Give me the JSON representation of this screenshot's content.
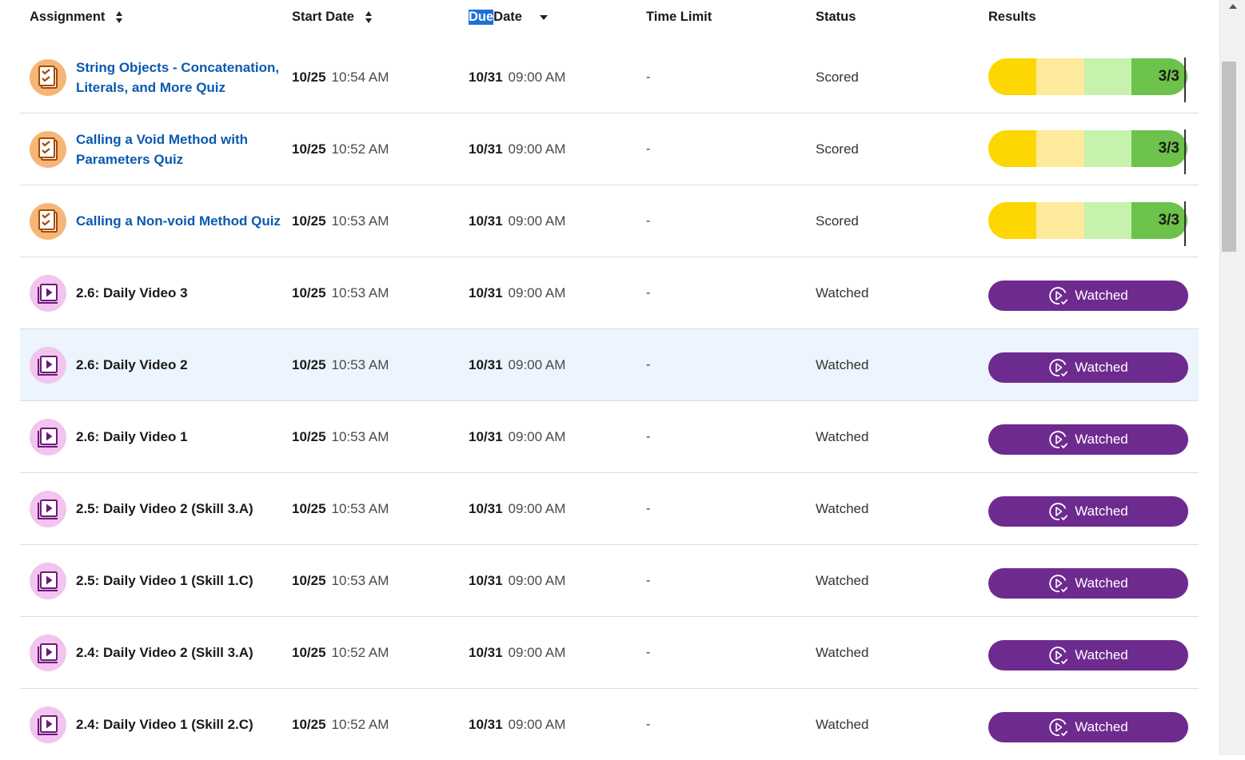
{
  "header": {
    "assignment": "Assignment",
    "start_date": "Start Date",
    "due_highlight": "Due",
    "due_rest": "Date",
    "time_limit": "Time Limit",
    "status": "Status",
    "results": "Results"
  },
  "colors": {
    "link": "#0a5ab0",
    "watched_button": "#6e2b8f",
    "score_segments": [
      "#fcd702",
      "#fdea9a",
      "#c6f2ad",
      "#6cc24a"
    ],
    "quiz_icon_bg": "#f5b677",
    "video_icon_bg": "#f2c4ee",
    "row_hover": "#ecf4fd"
  },
  "icons": {
    "quiz": "quiz-checklist-icon",
    "video": "video-play-icon",
    "watched": "play-check-icon"
  },
  "rows": [
    {
      "type": "quiz",
      "title": "String Objects - Concatenation, Literals, and More Quiz",
      "start_day": "10/25",
      "start_time": "10:54 AM",
      "due_day": "10/31",
      "due_time": "09:00 AM",
      "time_limit": "-",
      "status": "Scored",
      "score": "3/3"
    },
    {
      "type": "quiz",
      "title": "Calling a Void Method with Parameters Quiz",
      "start_day": "10/25",
      "start_time": "10:52 AM",
      "due_day": "10/31",
      "due_time": "09:00 AM",
      "time_limit": "-",
      "status": "Scored",
      "score": "3/3"
    },
    {
      "type": "quiz",
      "title": "Calling a Non-void Method Quiz",
      "start_day": "10/25",
      "start_time": "10:53 AM",
      "due_day": "10/31",
      "due_time": "09:00 AM",
      "time_limit": "-",
      "status": "Scored",
      "score": "3/3"
    },
    {
      "type": "video",
      "title": "2.6: Daily Video 3",
      "start_day": "10/25",
      "start_time": "10:53 AM",
      "due_day": "10/31",
      "due_time": "09:00 AM",
      "time_limit": "-",
      "status": "Watched",
      "result": "Watched"
    },
    {
      "type": "video",
      "title": "2.6: Daily Video 2",
      "start_day": "10/25",
      "start_time": "10:53 AM",
      "due_day": "10/31",
      "due_time": "09:00 AM",
      "time_limit": "-",
      "status": "Watched",
      "result": "Watched",
      "hover": true
    },
    {
      "type": "video",
      "title": "2.6: Daily Video 1",
      "start_day": "10/25",
      "start_time": "10:53 AM",
      "due_day": "10/31",
      "due_time": "09:00 AM",
      "time_limit": "-",
      "status": "Watched",
      "result": "Watched"
    },
    {
      "type": "video",
      "title": "2.5: Daily Video 2 (Skill 3.A)",
      "start_day": "10/25",
      "start_time": "10:53 AM",
      "due_day": "10/31",
      "due_time": "09:00 AM",
      "time_limit": "-",
      "status": "Watched",
      "result": "Watched"
    },
    {
      "type": "video",
      "title": "2.5: Daily Video 1 (Skill 1.C)",
      "start_day": "10/25",
      "start_time": "10:53 AM",
      "due_day": "10/31",
      "due_time": "09:00 AM",
      "time_limit": "-",
      "status": "Watched",
      "result": "Watched"
    },
    {
      "type": "video",
      "title": "2.4: Daily Video 2 (Skill 3.A)",
      "start_day": "10/25",
      "start_time": "10:52 AM",
      "due_day": "10/31",
      "due_time": "09:00 AM",
      "time_limit": "-",
      "status": "Watched",
      "result": "Watched"
    },
    {
      "type": "video",
      "title": "2.4: Daily Video 1 (Skill 2.C)",
      "start_day": "10/25",
      "start_time": "10:52 AM",
      "due_day": "10/31",
      "due_time": "09:00 AM",
      "time_limit": "-",
      "status": "Watched",
      "result": "Watched"
    }
  ]
}
